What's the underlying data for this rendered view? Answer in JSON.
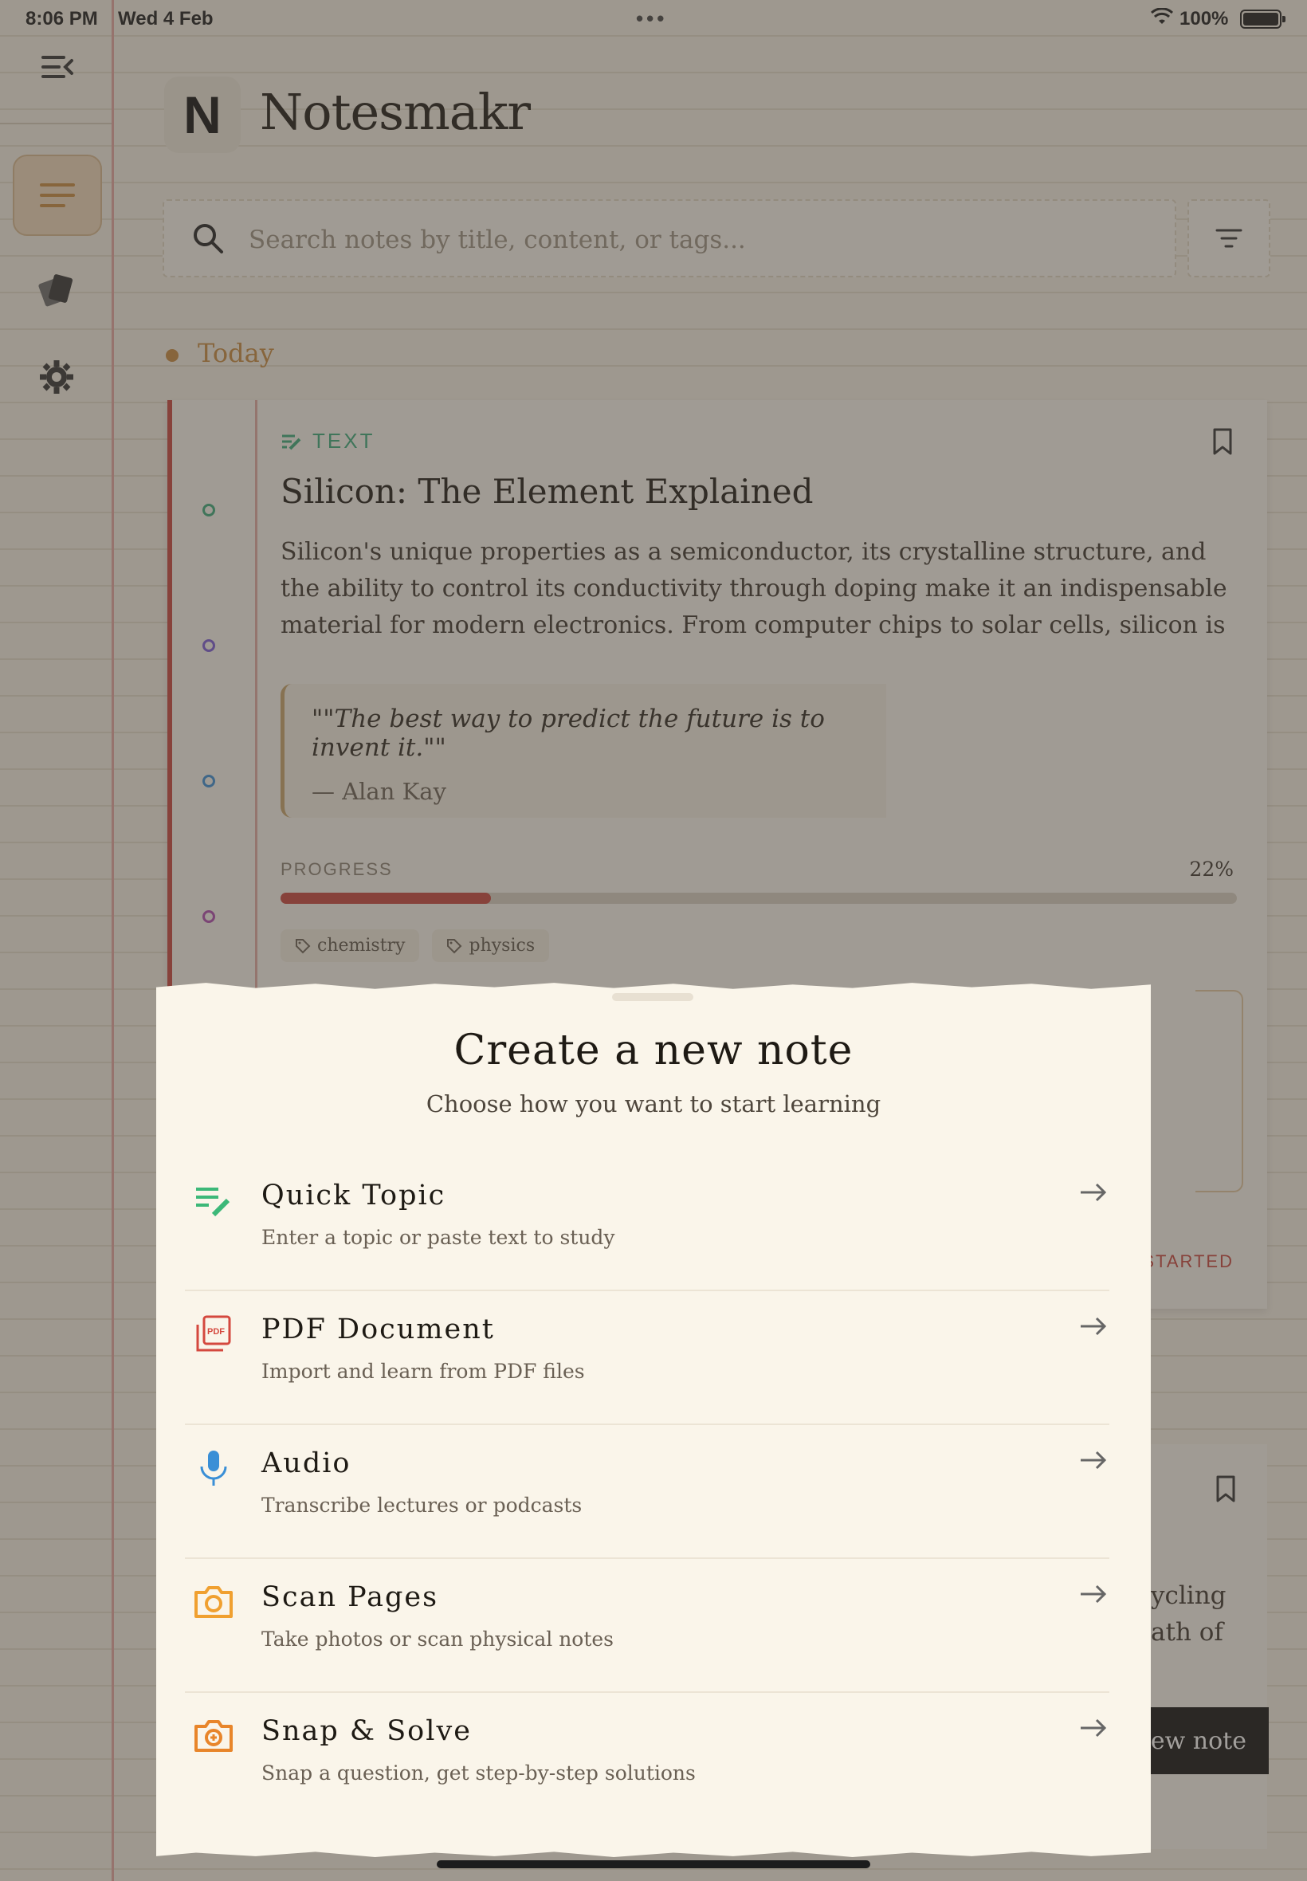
{
  "status_bar": {
    "time": "8:06 PM",
    "date": "Wed 4 Feb",
    "battery_percent": "100%",
    "battery_level": 1.0
  },
  "sidebar": {
    "icons": [
      "sidebar-collapse-icon",
      "notes-icon",
      "flashcards-icon",
      "gear-icon"
    ]
  },
  "header": {
    "logo_letter": "N",
    "app_title": "Notesmakr"
  },
  "search": {
    "placeholder": "Search notes by title, content, or tags..."
  },
  "section": {
    "label": "Today"
  },
  "note_card": {
    "type_label": "TEXT",
    "title": "Silicon: The Element Explained",
    "body": "Silicon's unique properties as a semiconductor, its crystalline structure, and the ability to control its conductivity through doping make it an indispensable material for modern electronics. From computer chips to solar cells, silicon is the silent workhorse powering…",
    "quote_text": "\"\"The best way to predict the future is to invent it.\"\"",
    "quote_author": "— Alan Kay",
    "progress_label": "PROGRESS",
    "progress_value_text": "22%",
    "progress_value": 0.22,
    "tags": [
      "chemistry",
      "physics"
    ],
    "status_fragment": "STARTED"
  },
  "second_card": {
    "line1_fragment": "ycling",
    "line2_fragment": "ath of"
  },
  "new_note_button": {
    "label_fragment": "lew note"
  },
  "sheet": {
    "title": "Create a new note",
    "subtitle": "Choose how you want to start learning",
    "options": [
      {
        "label": "Quick Topic",
        "description": "Enter a topic or paste text to study",
        "icon": "text-edit-icon",
        "color": "#3cb878"
      },
      {
        "label": "PDF Document",
        "description": "Import and learn from PDF files",
        "icon": "pdf-icon",
        "color": "#d4483e"
      },
      {
        "label": "Audio",
        "description": "Transcribe lectures or podcasts",
        "icon": "microphone-icon",
        "color": "#3a8fd6"
      },
      {
        "label": "Scan Pages",
        "description": "Take photos or scan physical notes",
        "icon": "camera-icon",
        "color": "#f0a030"
      },
      {
        "label": "Snap & Solve",
        "description": "Snap a question, get step-by-step solutions",
        "icon": "camera-plus-icon",
        "color": "#e8852a"
      }
    ]
  },
  "colors": {
    "accent_red": "#c8453c",
    "accent_gold": "#c98a3e",
    "text_type_green": "#3aaa7a"
  }
}
